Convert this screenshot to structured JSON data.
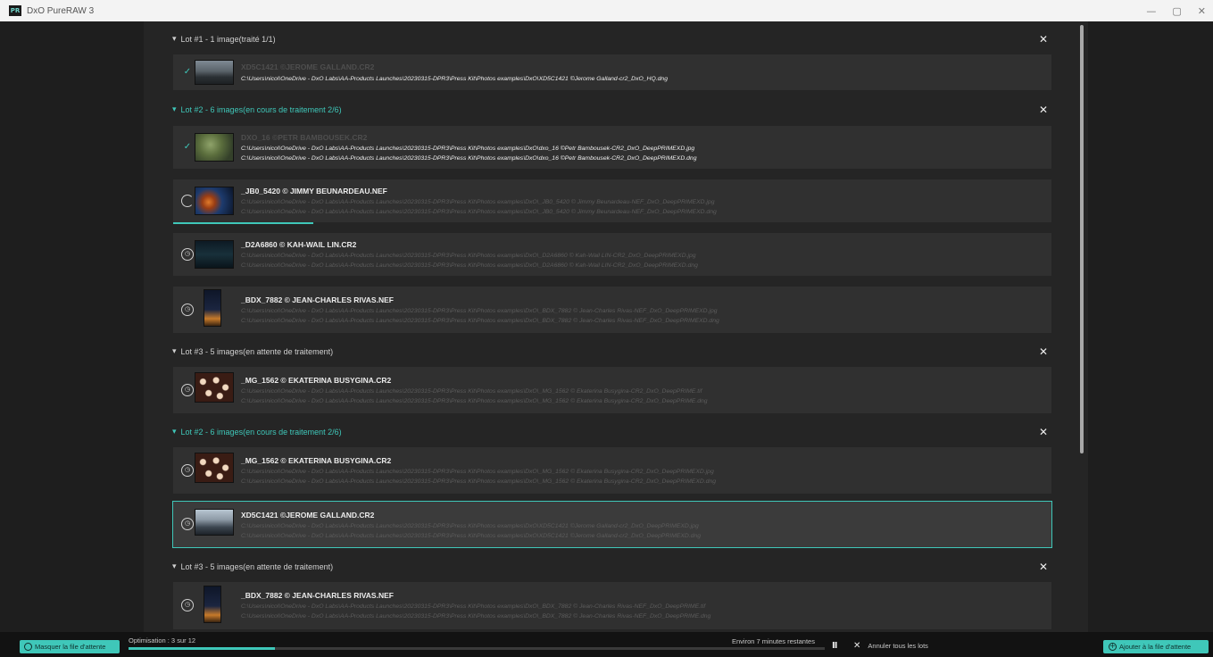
{
  "window": {
    "logo_text": "PR",
    "title": "DxO PureRAW 3",
    "minimize": "—",
    "maximize": "▢",
    "close": "✕"
  },
  "lots": [
    {
      "chevron": "▾",
      "title": "Lot #1 - 1 image(traité 1/1)",
      "close": "✕"
    },
    {
      "chevron": "▾",
      "title": "Lot #2 - 6 images(en cours de traitement 2/6)",
      "close": "✕"
    },
    {
      "chevron": "▾",
      "title": "Lot #3 - 5 images(en attente de traitement)",
      "close": "✕"
    },
    {
      "chevron": "▾",
      "title": "Lot #2 - 6 images(en cours de traitement 2/6)",
      "close": "✕"
    },
    {
      "chevron": "▾",
      "title": "Lot #3 - 5 images(en attente de traitement)",
      "close": "✕"
    }
  ],
  "items": [
    {
      "status_icon": "✓",
      "name": "XD5C1421 ©JEROME GALLAND.CR2",
      "path1": "C:\\Users\\nicol\\OneDrive - DxO Labs\\AA-Products Launches\\20230315-DPR3\\Press Kit\\Photos examples\\DxO\\XD5C1421 ©Jerome Galland-cr2_DxO_HQ.dng"
    },
    {
      "status_icon": "✓",
      "name": "DXO_16 ©PETR BAMBOUSEK.CR2",
      "path1": "C:\\Users\\nicol\\OneDrive - DxO Labs\\AA-Products Launches\\20230315-DPR3\\Press Kit\\Photos examples\\DxO\\dxo_16 ©Petr Bambousek-CR2_DxO_DeepPRIMEXD.jpg",
      "path2": "C:\\Users\\nicol\\OneDrive - DxO Labs\\AA-Products Launches\\20230315-DPR3\\Press Kit\\Photos examples\\DxO\\dxo_16 ©Petr Bambousek-CR2_DxO_DeepPRIMEXD.dng"
    },
    {
      "status_icon": "",
      "name": "_JB0_5420 © JIMMY BEUNARDEAU.NEF",
      "path1": "C:\\Users\\nicol\\OneDrive - DxO Labs\\AA-Products Launches\\20230315-DPR3\\Press Kit\\Photos examples\\DxO\\_JB0_5420 © Jimmy Beunardeau-NEF_DxO_DeepPRIMEXD.jpg",
      "path2": "C:\\Users\\nicol\\OneDrive - DxO Labs\\AA-Products Launches\\20230315-DPR3\\Press Kit\\Photos examples\\DxO\\_JB0_5420 © Jimmy Beunardeau-NEF_DxO_DeepPRIMEXD.dng",
      "progress": 0.16
    },
    {
      "status_icon": "◷",
      "name": "_D2A6860 © KAH-WAIL LIN.CR2",
      "path1": "C:\\Users\\nicol\\OneDrive - DxO Labs\\AA-Products Launches\\20230315-DPR3\\Press Kit\\Photos examples\\DxO\\_D2A6860 © Kah-Wail LIN-CR2_DxO_DeepPRIMEXD.jpg",
      "path2": "C:\\Users\\nicol\\OneDrive - DxO Labs\\AA-Products Launches\\20230315-DPR3\\Press Kit\\Photos examples\\DxO\\_D2A6860 © Kah-Wail LIN-CR2_DxO_DeepPRIMEXD.dng"
    },
    {
      "status_icon": "◷",
      "name": "_BDX_7882 © JEAN-CHARLES RIVAS.NEF",
      "path1": "C:\\Users\\nicol\\OneDrive - DxO Labs\\AA-Products Launches\\20230315-DPR3\\Press Kit\\Photos examples\\DxO\\_BDX_7882 © Jean-Charles Rivas-NEF_DxO_DeepPRIMEXD.jpg",
      "path2": "C:\\Users\\nicol\\OneDrive - DxO Labs\\AA-Products Launches\\20230315-DPR3\\Press Kit\\Photos examples\\DxO\\_BDX_7882 © Jean-Charles Rivas-NEF_DxO_DeepPRIMEXD.dng"
    },
    {
      "status_icon": "◷",
      "name": "_MG_1562 © EKATERINA BUSYGINA.CR2",
      "path1": "C:\\Users\\nicol\\OneDrive - DxO Labs\\AA-Products Launches\\20230315-DPR3\\Press Kit\\Photos examples\\DxO\\_MG_1562 © Ekaterina Busygina-CR2_DxO_DeepPRIME.tif",
      "path2": "C:\\Users\\nicol\\OneDrive - DxO Labs\\AA-Products Launches\\20230315-DPR3\\Press Kit\\Photos examples\\DxO\\_MG_1562 © Ekaterina Busygina-CR2_DxO_DeepPRIME.dng"
    },
    {
      "status_icon": "◷",
      "name": "_MG_1562 © EKATERINA BUSYGINA.CR2",
      "path1": "C:\\Users\\nicol\\OneDrive - DxO Labs\\AA-Products Launches\\20230315-DPR3\\Press Kit\\Photos examples\\DxO\\_MG_1562 © Ekaterina Busygina-CR2_DxO_DeepPRIMEXD.jpg",
      "path2": "C:\\Users\\nicol\\OneDrive - DxO Labs\\AA-Products Launches\\20230315-DPR3\\Press Kit\\Photos examples\\DxO\\_MG_1562 © Ekaterina Busygina-CR2_DxO_DeepPRIMEXD.dng"
    },
    {
      "status_icon": "◷",
      "name": "XD5C1421 ©JEROME GALLAND.CR2",
      "path1": "C:\\Users\\nicol\\OneDrive - DxO Labs\\AA-Products Launches\\20230315-DPR3\\Press Kit\\Photos examples\\DxO\\XD5C1421 ©Jerome Galland-cr2_DxO_DeepPRIMEXD.jpg",
      "path2": "C:\\Users\\nicol\\OneDrive - DxO Labs\\AA-Products Launches\\20230315-DPR3\\Press Kit\\Photos examples\\DxO\\XD5C1421 ©Jerome Galland-cr2_DxO_DeepPRIMEXD.dng"
    },
    {
      "status_icon": "◷",
      "name": "_BDX_7882 © JEAN-CHARLES RIVAS.NEF",
      "path1": "C:\\Users\\nicol\\OneDrive - DxO Labs\\AA-Products Launches\\20230315-DPR3\\Press Kit\\Photos examples\\DxO\\_BDX_7882 © Jean-Charles Rivas-NEF_DxO_DeepPRIME.tif",
      "path2": "C:\\Users\\nicol\\OneDrive - DxO Labs\\AA-Products Launches\\20230315-DPR3\\Press Kit\\Photos examples\\DxO\\_BDX_7882 © Jean-Charles Rivas-NEF_DxO_DeepPRIME.dng"
    }
  ],
  "bottom": {
    "hide_queue_label": "Masquer la file d'attente",
    "optimisation_label": "Optimisation : 3 sur 12",
    "optimisation_progress": 0.21,
    "eta": "Environ 7 minutes restantes",
    "pause_icon": "II",
    "cancel_icon": "✕",
    "cancel_all_label": "Annuler tous les lots",
    "add_icon": "+",
    "add_label": "Ajouter à la file d'attente"
  },
  "colors": {
    "accent": "#3fc7b9",
    "background": "#252525",
    "row": "#303030"
  }
}
